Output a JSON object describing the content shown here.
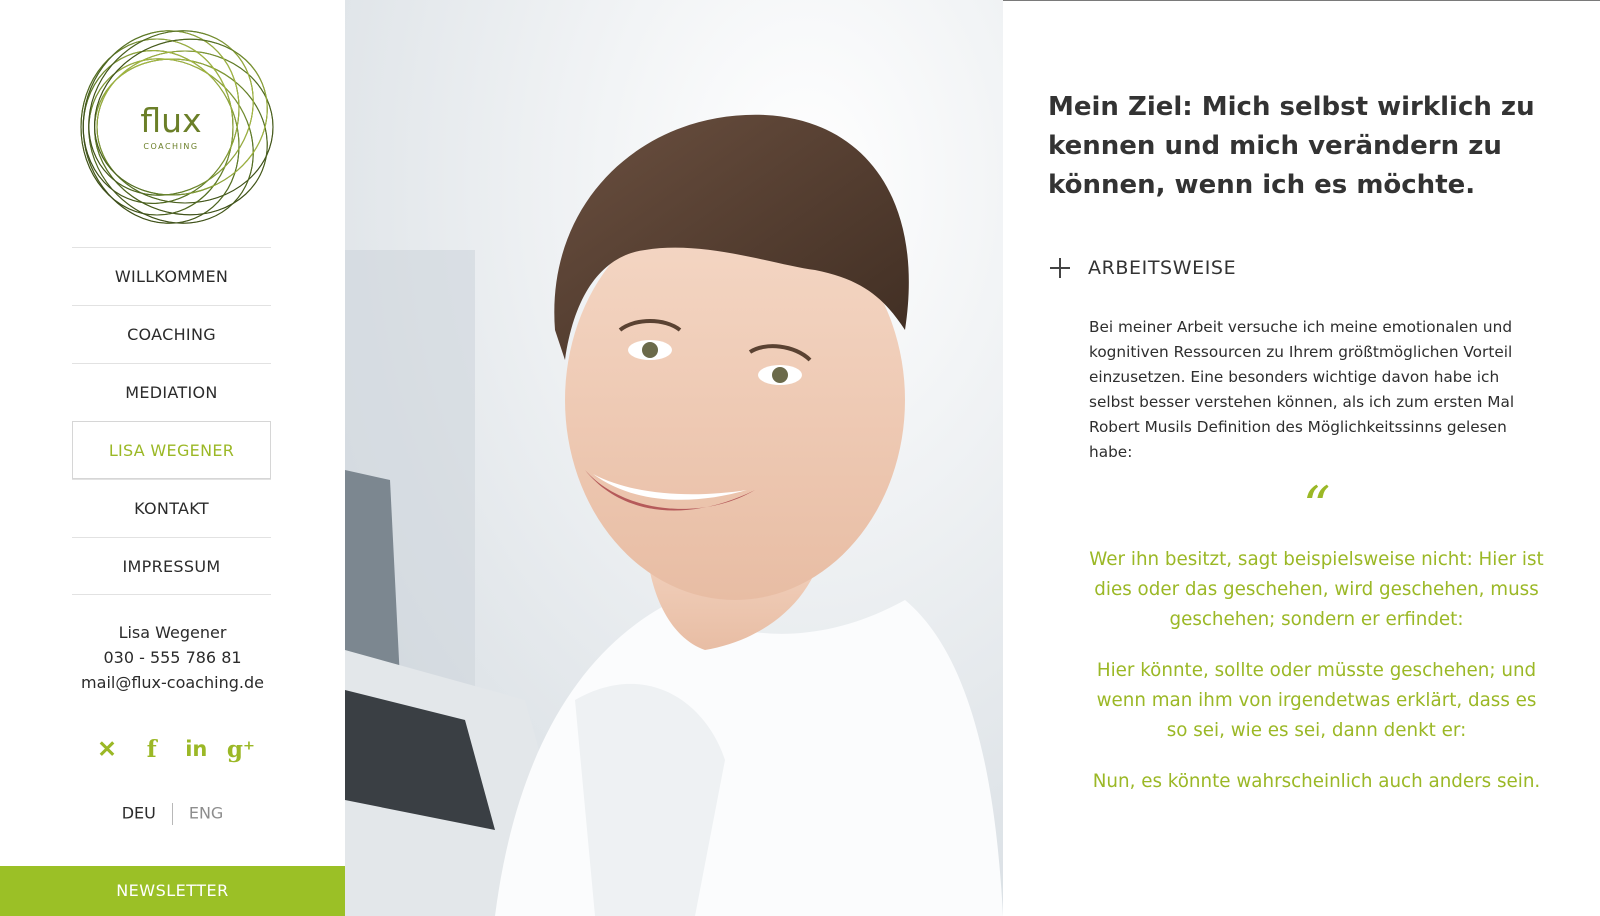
{
  "colors": {
    "accent": "#9bb826",
    "newsletter_bg": "#9bc026",
    "text": "#333333",
    "muted": "#8d8d8d"
  },
  "logo": {
    "name": "flux",
    "sub": "COACHING"
  },
  "nav": {
    "items": [
      {
        "label": "WILLKOMMEN",
        "active": false
      },
      {
        "label": "COACHING",
        "active": false
      },
      {
        "label": "MEDIATION",
        "active": false
      },
      {
        "label": "LISA WEGENER",
        "active": true
      },
      {
        "label": "KONTAKT",
        "active": false
      },
      {
        "label": "IMPRESSUM",
        "active": false
      }
    ]
  },
  "contact": {
    "name": "Lisa Wegener",
    "phone": "030 - 555 786 81",
    "email": "mail@flux-coaching.de"
  },
  "social": {
    "icons": [
      "xing-icon",
      "facebook-icon",
      "linkedin-icon",
      "google-plus-icon"
    ]
  },
  "lang": {
    "deu": "DEU",
    "eng": "ENG"
  },
  "newsletter": {
    "label": "NEWSLETTER"
  },
  "content": {
    "headline": "Mein Ziel: Mich selbst wirklich zu kennen und mich verändern zu können, wenn ich es möchte.",
    "section_title": "ARBEITSWEISE",
    "body": "Bei meiner Arbeit versuche ich meine emotionalen und kognitiven Ressourcen zu Ihrem größtmöglichen Vorteil einzusetzen. Eine besonders wichtige davon habe ich selbst besser verstehen können, als ich zum ersten Mal Robert Musils Definition des Möglichkeitssinns gelesen habe:",
    "quote_mark": "“",
    "quote_p1": "Wer ihn besitzt, sagt beispielsweise nicht: Hier ist dies oder das geschehen, wird geschehen, muss geschehen; sondern er erfindet:",
    "quote_p2": "Hier könnte, sollte oder müsste geschehen; und wenn man ihm von irgendetwas erklärt, dass es so sei, wie es sei, dann denkt er:",
    "quote_p3": "Nun, es könnte wahrscheinlich auch anders sein."
  }
}
